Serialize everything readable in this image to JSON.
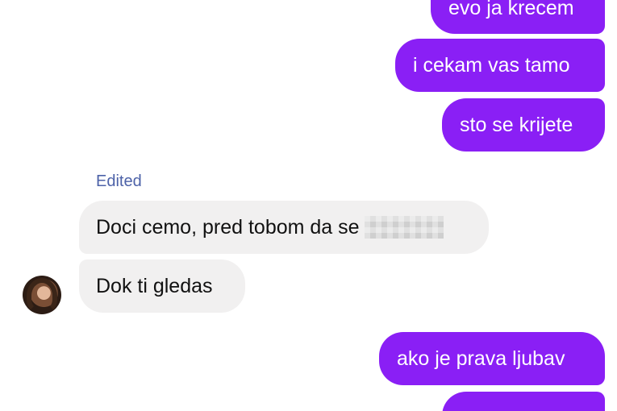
{
  "colors": {
    "outgoing_bubble": "#8a1ff5",
    "incoming_bubble": "#f1f0f0",
    "edited_label": "#4d62a8"
  },
  "messages_top": [
    {
      "text": "evo ja krecem",
      "direction": "outgoing"
    },
    {
      "text": "i cekam vas tamo",
      "direction": "outgoing"
    },
    {
      "text": "sto se krijete",
      "direction": "outgoing"
    }
  ],
  "edited_label": "Edited",
  "messages_incoming": [
    {
      "text": "Doci cemo, pred tobom da se",
      "direction": "incoming",
      "redacted": true
    },
    {
      "text": "Dok ti gledas",
      "direction": "incoming"
    }
  ],
  "messages_bottom": [
    {
      "text": "ako je prava ljubav",
      "direction": "outgoing"
    }
  ],
  "icons": {
    "avatar": "contact-avatar-icon"
  }
}
